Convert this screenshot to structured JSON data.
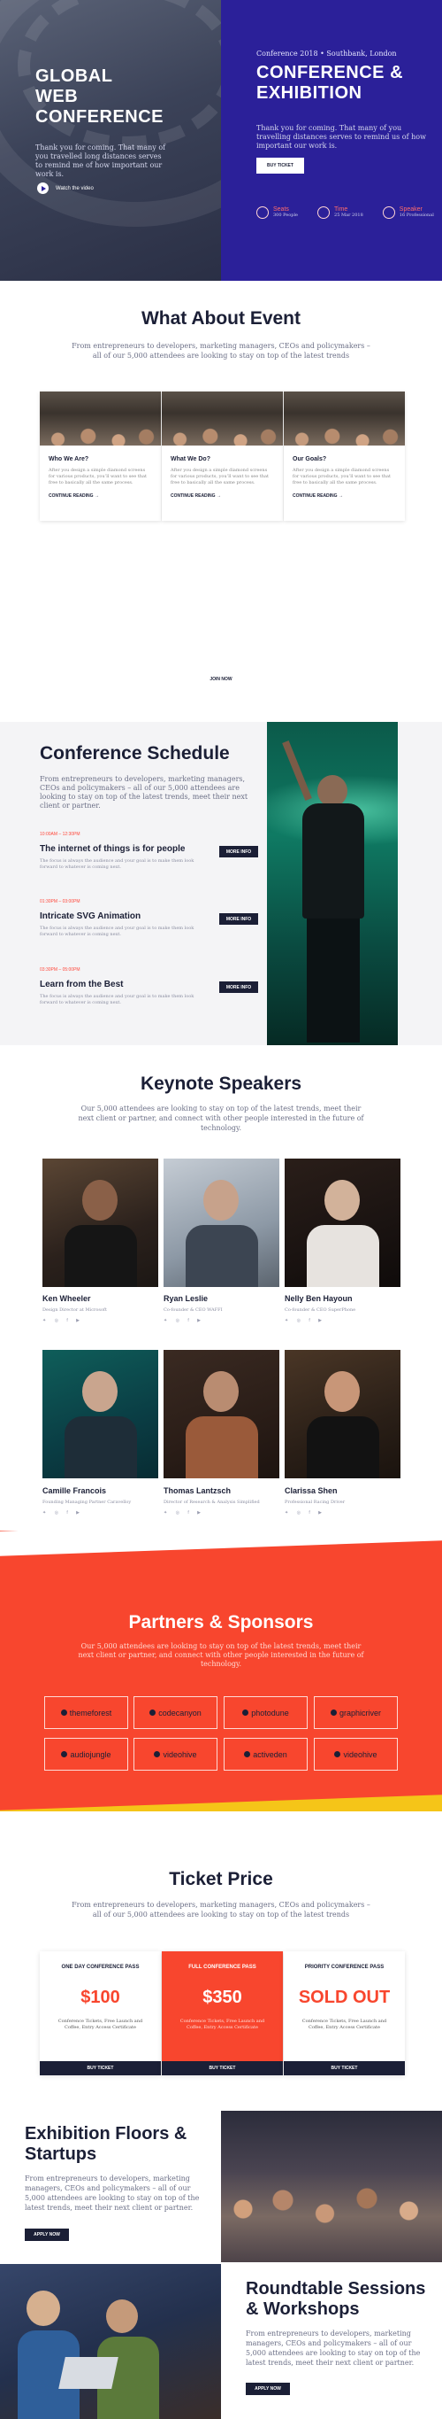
{
  "hero": {
    "left_title_lines": [
      "GLOBAL",
      "WEB",
      "CONFERENCE"
    ],
    "left_text": "Thank you for coming. That many of you travelled long distances serves to remind me of how important our work is.",
    "watch_label": "Watch the video",
    "meta": "Conference 2018  • Southbank, London",
    "right_title_lines": [
      "CONFERENCE &",
      "EXHIBITION"
    ],
    "right_text": "Thank you for coming. That many of you travelling distances serves to remind us of how important our work is.",
    "buy_label": "BUY TICKET",
    "stats": [
      {
        "label": "Seats",
        "value": "300 People"
      },
      {
        "label": "Time",
        "value": "25 Mar 2018"
      },
      {
        "label": "Speaker",
        "value": "16 Professional"
      }
    ]
  },
  "about": {
    "title": "What About Event",
    "subtitle": "From entrepreneurs to developers, marketing managers, CEOs and policymakers – all of our 5,000 attendees are looking to stay on top of the latest trends",
    "cards": [
      {
        "title": "Who We Are?",
        "text": "After you design a simple diamond screens for various products, you’ll want to see that free to basically all the same process.",
        "more": "CONTINUE READING →"
      },
      {
        "title": "What We Do?",
        "text": "After you design a simple diamond screens for various products, you’ll want to see that free to basically all the same process.",
        "more": "CONTINUE READING →"
      },
      {
        "title": "Our Goals?",
        "text": "After you design a simple diamond screens for various products, you’ll want to see that free to basically all the same process.",
        "more": "CONTINUE READING →"
      }
    ],
    "join_label": "JOIN NOW"
  },
  "schedule": {
    "title": "Conference Schedule",
    "subtitle": "From entrepreneurs to developers, marketing managers, CEOs and policymakers – all of our 5,000 attendees are looking to stay on top of the latest trends, meet their next client or partner.",
    "items": [
      {
        "time": "10:00AM – 12:30PM",
        "title": "The internet of things is for people",
        "text": "The focus is always the audience and your goal is to make them look forward to whatever is coming next.",
        "btn": "MORE INFO"
      },
      {
        "time": "01:30PM – 03:00PM",
        "title": "Intricate SVG Animation",
        "text": "The focus is always the audience and your goal is to make them look forward to whatever is coming next.",
        "btn": "MORE INFO"
      },
      {
        "time": "03:30PM – 05:00PM",
        "title": "Learn from the Best",
        "text": "The focus is always the audience and your goal is to make them look forward to whatever is coming next.",
        "btn": "MORE INFO"
      }
    ]
  },
  "speakers": {
    "title": "Keynote Speakers",
    "subtitle": "Our 5,000 attendees are looking to stay on top of the latest trends, meet their next client or partner, and connect with other people interested in the future of technology.",
    "list": [
      {
        "name": "Ken Wheeler",
        "role": "Design Director at Microsoft",
        "social": "✦ ◎ f ▶"
      },
      {
        "name": "Ryan Leslie",
        "role": "Co-founder & CEO WAFFI",
        "social": "✦ ◎ f ▶"
      },
      {
        "name": "Nelly Ben Hayoun",
        "role": "Co-founder & CEO SuperPhone",
        "social": "✦ ◎ f ▶"
      },
      {
        "name": "Camille Francois",
        "role": "Founding Managing Partner Caravelloy",
        "social": "✦ ◎ f ▶"
      },
      {
        "name": "Thomas Lantzsch",
        "role": "Director of Research & Analysis Simplified",
        "social": "✦ ◎ f ▶"
      },
      {
        "name": "Clarissa Shen",
        "role": "Professional Racing Driver",
        "social": "✦ ◎ f ▶"
      }
    ]
  },
  "partners": {
    "title": "Partners & Sponsors",
    "subtitle": "Our 5,000 attendees are looking to stay on top of the latest trends, meet their next client or partner, and connect with other people interested in the future of technology.",
    "logos": [
      "themeforest",
      "codecanyon",
      "photodune",
      "graphicriver",
      "audiojungle",
      "videohive",
      "activeden",
      "videohive"
    ]
  },
  "tickets": {
    "title": "Ticket Price",
    "subtitle": "From entrepreneurs to developers, marketing managers, CEOs and policymakers – all of our 5,000 attendees are looking to stay on top of the latest trends",
    "plans": [
      {
        "name": "ONE DAY CONFERENCE PASS",
        "price": "$100",
        "desc": "Conference Tickets, Free Launch and Coffee, Entry Access Certificate",
        "btn": "BUY TICKET"
      },
      {
        "name": "FULL CONFERENCE PASS",
        "price": "$350",
        "desc": "Conference Tickets, Free Launch and Coffee, Entry Access Certificate",
        "btn": "BUY TICKET"
      },
      {
        "name": "PRIORITY CONFERENCE PASS",
        "price": "SOLD OUT",
        "desc": "Conference Tickets, Free Launch and Coffee, Entry Access Certificate",
        "btn": "BUY TICKET"
      }
    ]
  },
  "exhibition": {
    "title_lines": [
      "Exhibition Floors &",
      "Startups"
    ],
    "text": "From entrepreneurs to developers, marketing managers, CEOs and policymakers – all of our 5,000 attendees are looking to stay on top of the latest trends, meet their next client or partner.",
    "btn": "APPLY NOW"
  },
  "roundtable": {
    "title_lines": [
      "Roundtable Sessions",
      "& Workshops"
    ],
    "text": "From entrepreneurs to developers, marketing managers, CEOs and policymakers – all of our 5,000 attendees are looking to stay on top of the latest trends, meet their next client or partner.",
    "btn": "APPLY NOW"
  },
  "colors": {
    "primary": "#2b2099",
    "accent": "#f8462e",
    "dark": "#1b1f36",
    "yellow": "#f5c518"
  }
}
